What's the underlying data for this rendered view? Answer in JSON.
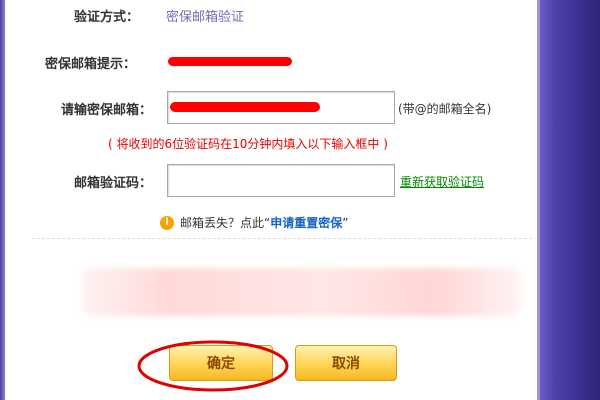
{
  "form": {
    "verify_method_label": "验证方式：",
    "verify_method_value": "密保邮箱验证",
    "email_hint_label": "密保邮箱提示：",
    "email_input_label": "请输密保邮箱：",
    "email_input_value": "",
    "email_input_hint": "(带@的邮箱全名)",
    "notice": "( 将收到的6位验证码在10分钟内填入以下输入框中 )",
    "code_label": "邮箱验证码：",
    "code_input_value": "",
    "resend_link": "重新获取验证码",
    "lost_email_prefix": "邮箱丢失？点此",
    "reset_link": "申请重置密保",
    "quote_open": "“",
    "quote_close": "”"
  },
  "buttons": {
    "confirm": "确定",
    "cancel": "取消"
  },
  "colors": {
    "accent_purple": "#7a66b8",
    "notice_red": "#e60000",
    "link_green": "#008a00",
    "link_blue": "#1863c7",
    "button_gold": "#ffd75a",
    "annotation_red": "#e00000"
  },
  "icons": {
    "warning": "info-circle-icon"
  }
}
